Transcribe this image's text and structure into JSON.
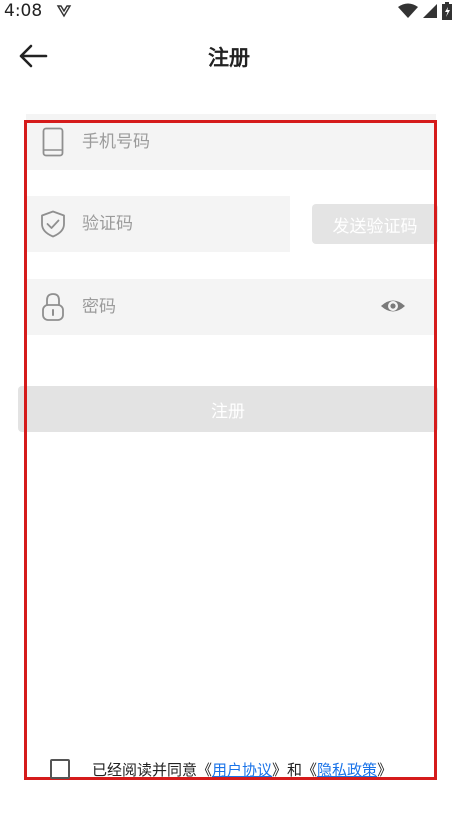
{
  "status": {
    "time": "4:08"
  },
  "header": {
    "title": "注册"
  },
  "form": {
    "phone_placeholder": "手机号码",
    "code_placeholder": "验证码",
    "send_code_label": "发送验证码",
    "password_placeholder": "密码"
  },
  "actions": {
    "register_label": "注册"
  },
  "agreement": {
    "prefix": "已经阅读并同意《",
    "user_agreement": "用户协议",
    "middle": "》和《",
    "privacy_policy": "隐私政策",
    "suffix": "》"
  },
  "colors": {
    "frame": "#d51b1b",
    "link": "#1a73e8",
    "field_bg": "#f4f4f4",
    "disabled_button": "#e3e3e3"
  },
  "icons": [
    "app-icon",
    "wifi-icon",
    "signal-icon",
    "battery-icon",
    "back-arrow-icon",
    "phone-icon",
    "shield-check-icon",
    "lock-icon",
    "eye-icon"
  ]
}
